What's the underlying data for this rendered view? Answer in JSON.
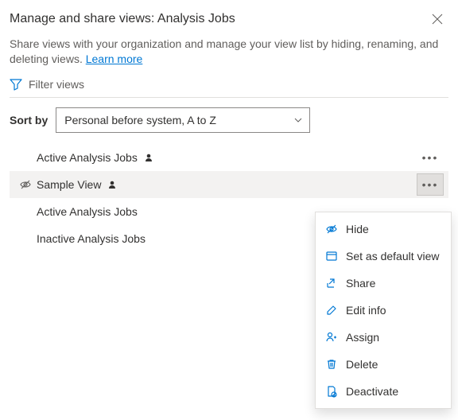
{
  "header": {
    "title": "Manage and share views: Analysis Jobs"
  },
  "description": {
    "text": "Share views with your organization and manage your view list by hiding, renaming, and deleting views. ",
    "link_label": "Learn more"
  },
  "filter": {
    "label": "Filter views"
  },
  "sort": {
    "label": "Sort by",
    "selected": "Personal before system, A to Z"
  },
  "views": [
    {
      "label": "Active Analysis Jobs",
      "personal": true,
      "hidden": false,
      "hovered": false,
      "show_more": true
    },
    {
      "label": "Sample View",
      "personal": true,
      "hidden": true,
      "hovered": true,
      "show_more": true
    },
    {
      "label": "Active Analysis Jobs",
      "personal": false,
      "hidden": false,
      "hovered": false,
      "show_more": false
    },
    {
      "label": "Inactive Analysis Jobs",
      "personal": false,
      "hidden": false,
      "hovered": false,
      "show_more": false
    }
  ],
  "context_menu": {
    "for_view_index": 1,
    "items": [
      {
        "icon": "hide",
        "label": "Hide"
      },
      {
        "icon": "default",
        "label": "Set as default view"
      },
      {
        "icon": "share",
        "label": "Share"
      },
      {
        "icon": "edit",
        "label": "Edit info"
      },
      {
        "icon": "assign",
        "label": "Assign"
      },
      {
        "icon": "delete",
        "label": "Delete"
      },
      {
        "icon": "deactivate",
        "label": "Deactivate"
      }
    ]
  },
  "colors": {
    "accent": "#0078d4"
  }
}
